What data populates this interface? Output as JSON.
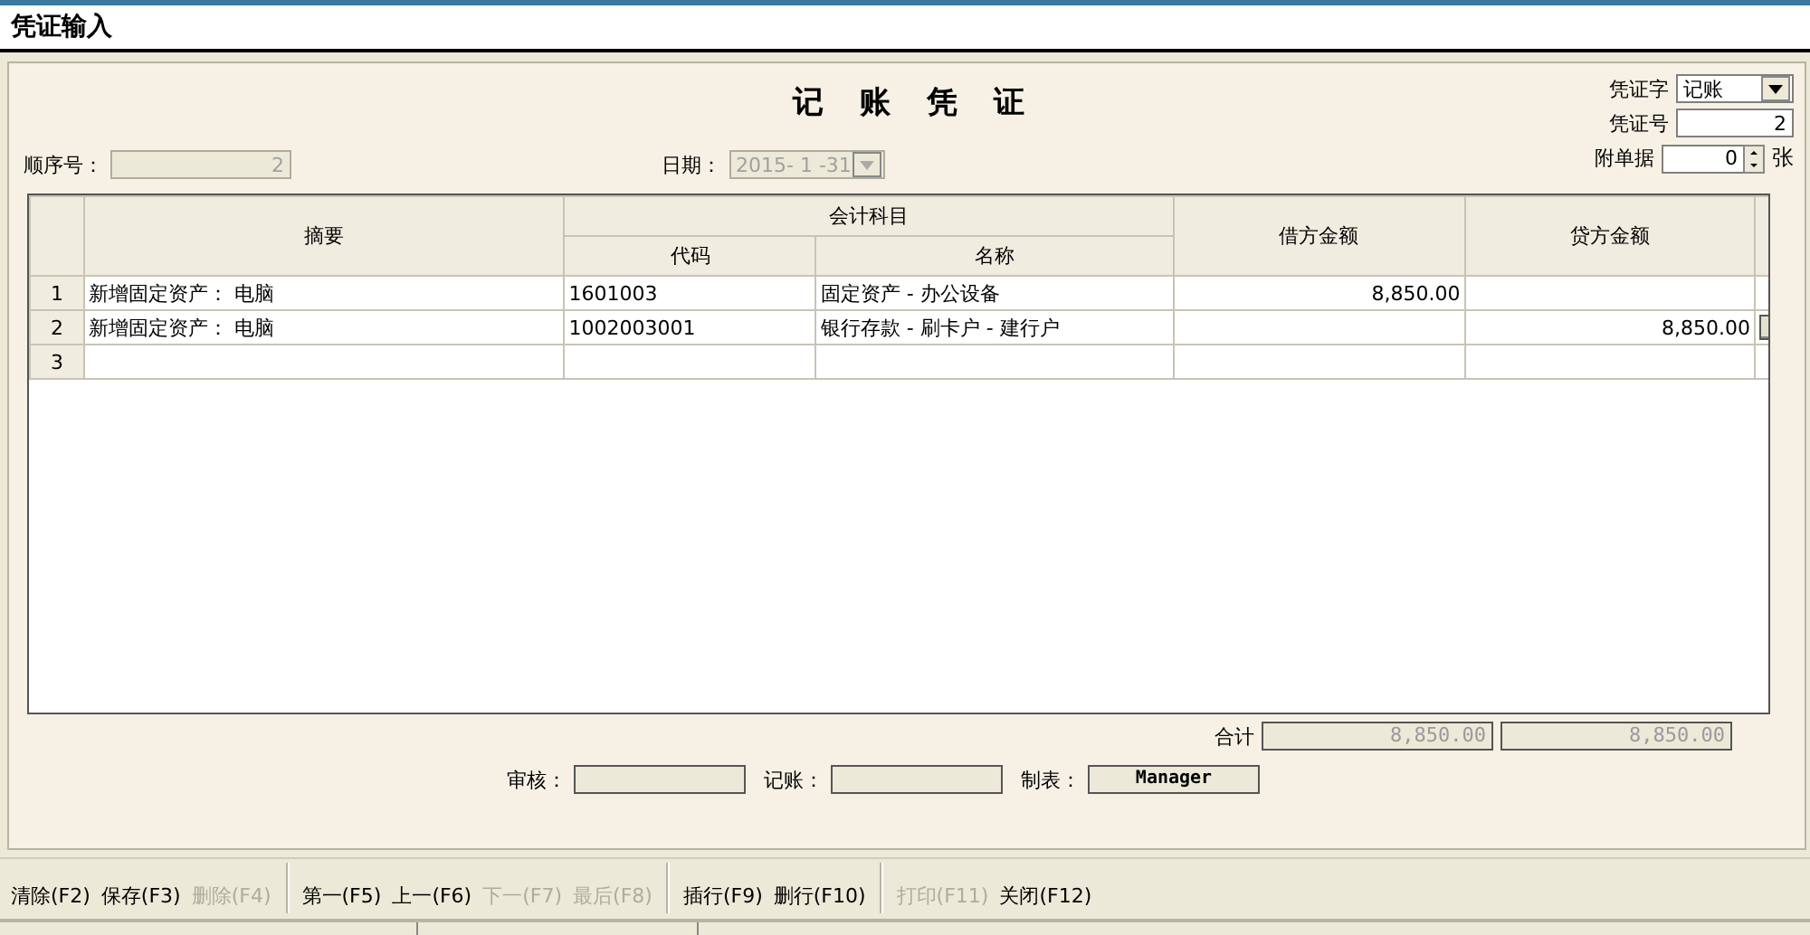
{
  "window": {
    "title": "凭证输入"
  },
  "header": {
    "title": "记 账 凭 证",
    "serial": {
      "label": "顺序号：",
      "value": "2",
      "disabled": true
    },
    "date": {
      "label": "日期：",
      "value": "2015- 1 -31",
      "disabled": true
    },
    "voucher_type": {
      "label": "凭证字",
      "value": "记账"
    },
    "voucher_no": {
      "label": "凭证号",
      "value": "2"
    },
    "attachments": {
      "label": "附单据",
      "value": "0",
      "unit": "张"
    }
  },
  "grid": {
    "group_header": "会计科目",
    "columns": [
      "摘要",
      "代码",
      "名称",
      "借方金额",
      "贷方金额"
    ],
    "rows": [
      {
        "number": "1",
        "summary": "新增固定资产： 电脑",
        "code": "1601003",
        "name": "固定资产 - 办公设备",
        "debit": "8,850.00",
        "selected": false
      },
      {
        "number": "2",
        "summary": "新增固定资产： 电脑",
        "code": "1002003001",
        "name": "银行存款 - 刷卡户 - 建行户",
        "credit": "8,850.00",
        "selected": true
      },
      {
        "number": "3",
        "selected": false
      }
    ]
  },
  "totals": {
    "label": "合计",
    "debit": "8,850.00",
    "credit": "8,850.00"
  },
  "signatures": [
    {
      "label": "审核："
    },
    {
      "label": "记账："
    },
    {
      "label": "制表：",
      "value": "Manager"
    }
  ],
  "toolbar": [
    [
      {
        "label": "清除(F2)",
        "disabled": false
      },
      {
        "label": "保存(F3)",
        "disabled": false
      },
      {
        "label": "删除(F4)",
        "disabled": true
      }
    ],
    [
      {
        "label": "第一(F5)",
        "disabled": false
      },
      {
        "label": "上一(F6)",
        "disabled": false
      },
      {
        "label": "下一(F7)",
        "disabled": true
      },
      {
        "label": "最后(F8)",
        "disabled": true
      }
    ],
    [
      {
        "label": "插行(F9)",
        "disabled": false
      },
      {
        "label": "删行(F10)",
        "disabled": false
      }
    ],
    [
      {
        "label": "打印(F11)",
        "disabled": true
      },
      {
        "label": "关闭(F12)",
        "disabled": false
      }
    ]
  ]
}
